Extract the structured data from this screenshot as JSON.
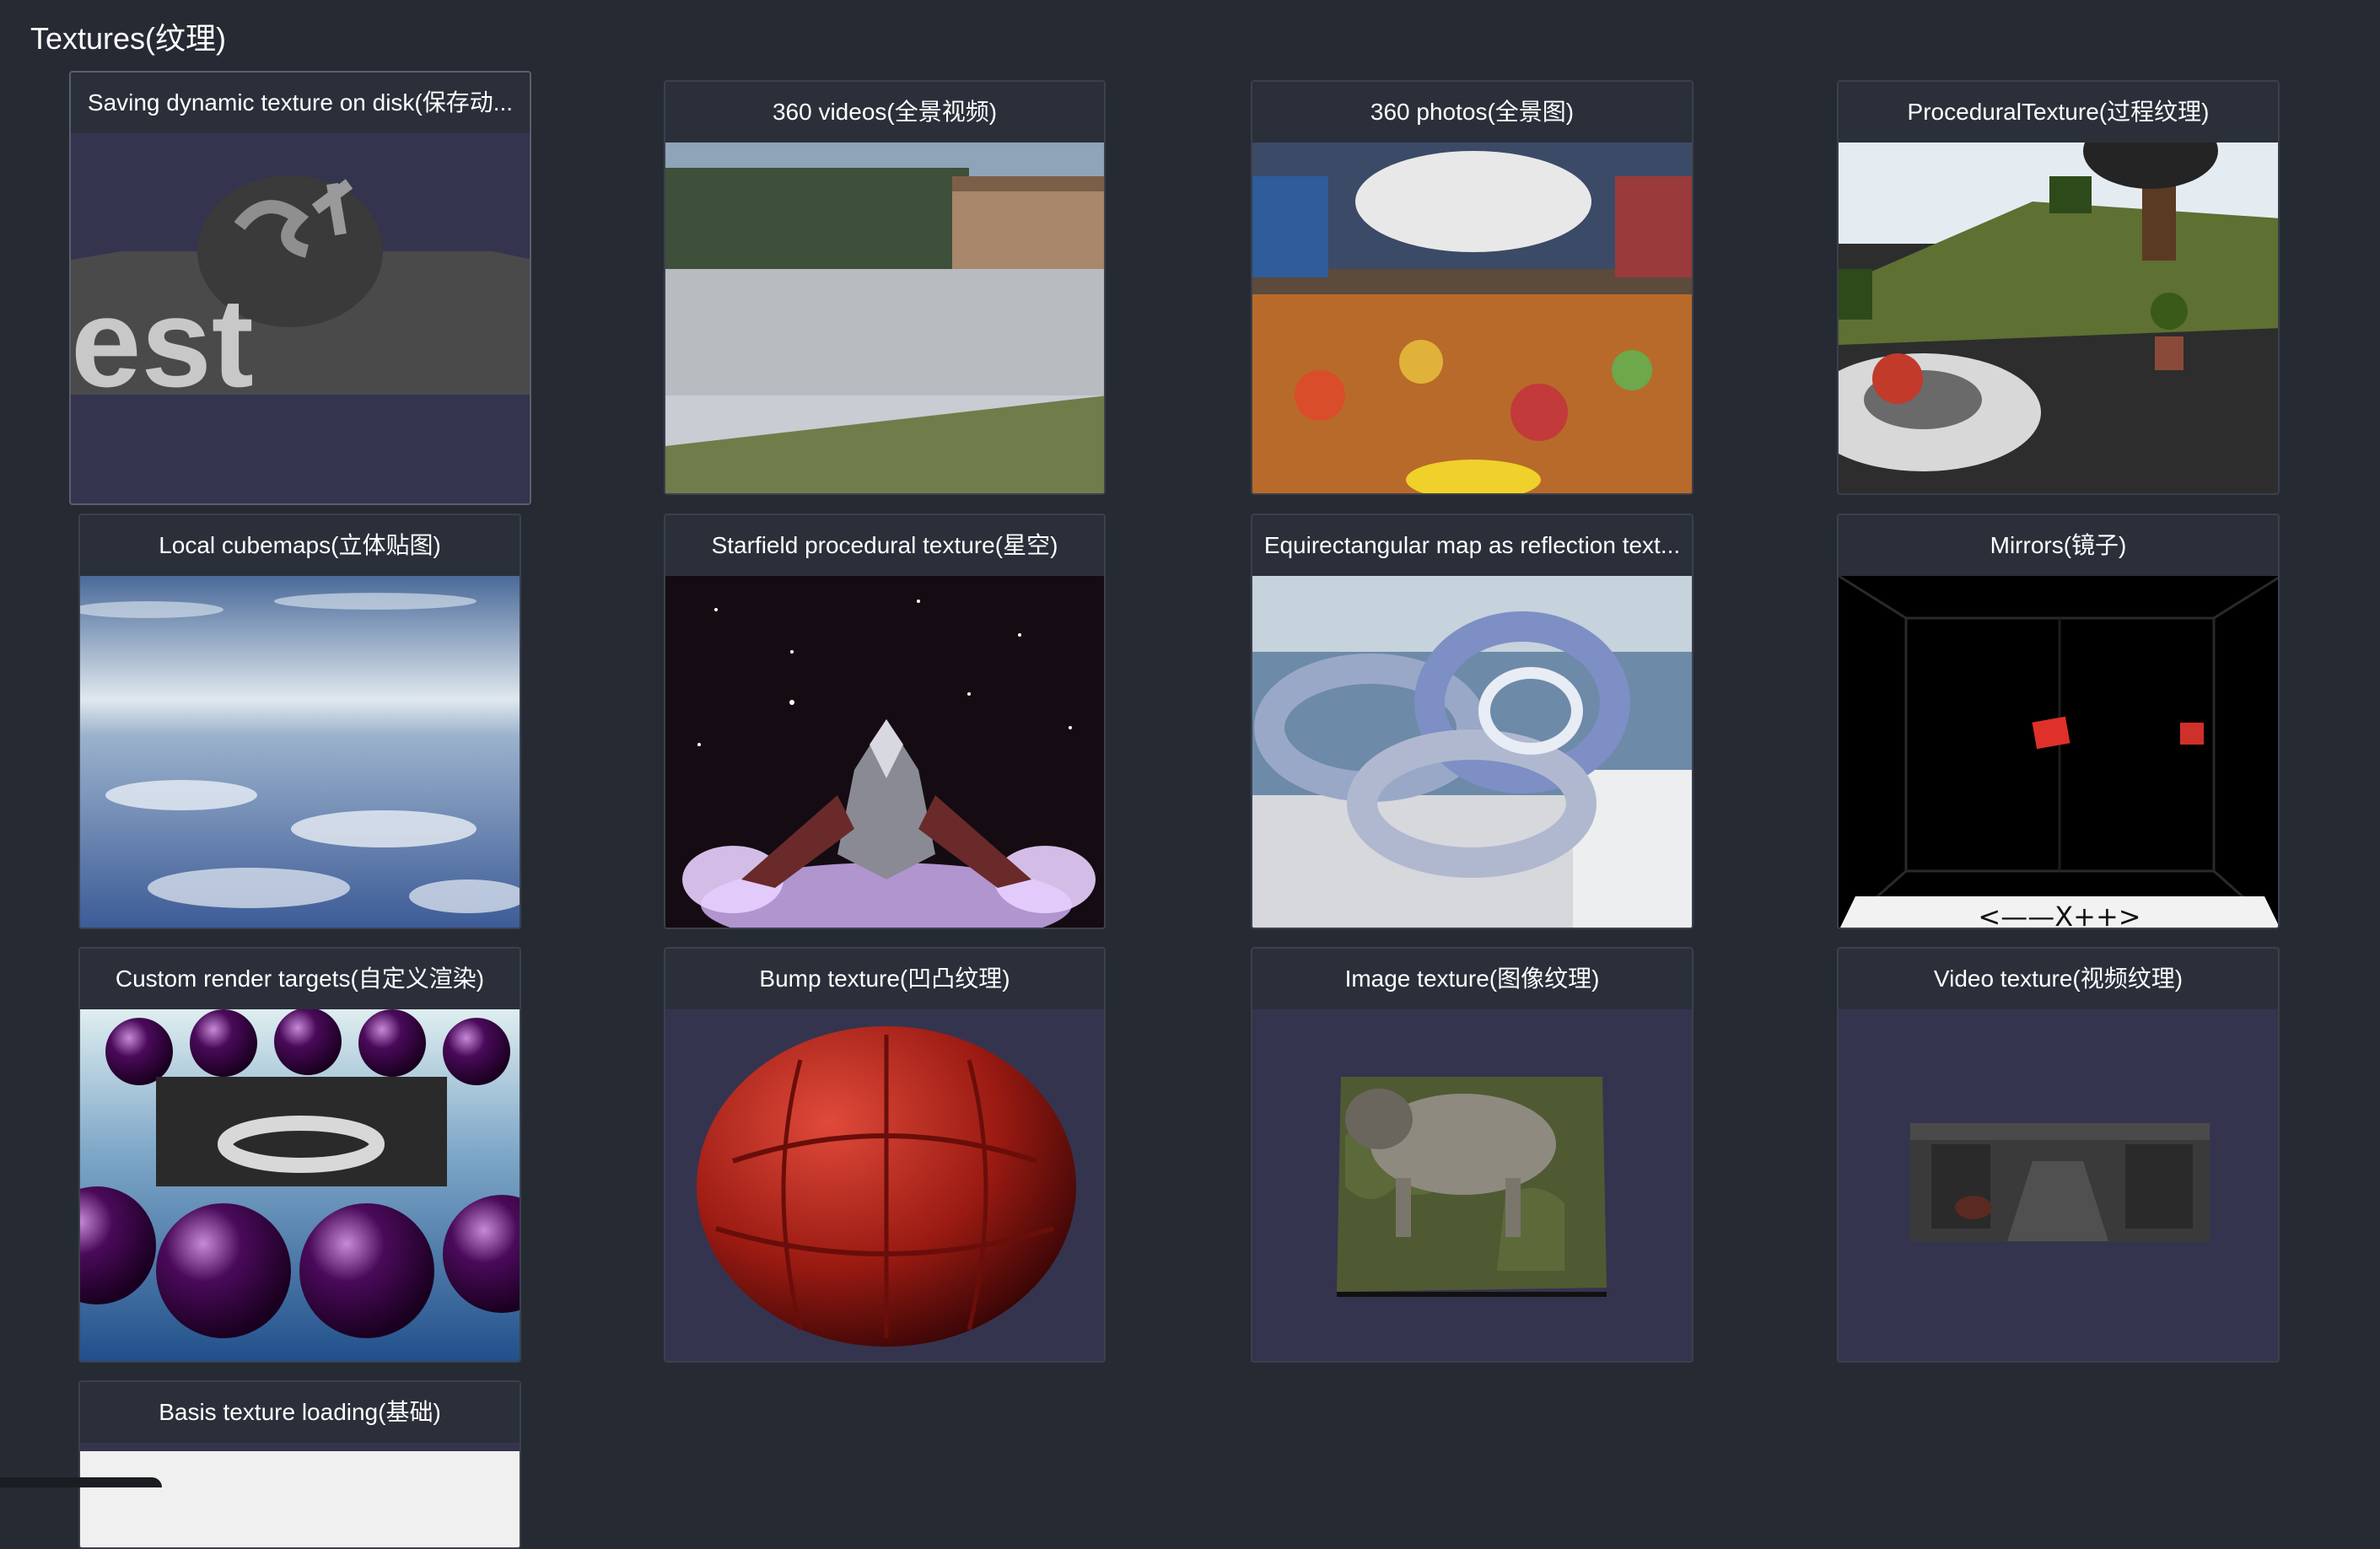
{
  "page": {
    "title": "Textures(纹理)"
  },
  "cards": [
    {
      "title": "Saving dynamic texture on disk(保存动...",
      "icon": "dynamic-texture-preview"
    },
    {
      "title": "360 videos(全景视频)",
      "icon": "panorama-video-preview"
    },
    {
      "title": "360 photos(全景图)",
      "icon": "panorama-photo-preview"
    },
    {
      "title": "ProceduralTexture(过程纹理)",
      "icon": "procedural-texture-preview"
    },
    {
      "title": "Local cubemaps(立体贴图)",
      "icon": "cubemap-sky-preview"
    },
    {
      "title": "Starfield procedural texture(星空)",
      "icon": "starfield-spaceship-preview"
    },
    {
      "title": "Equirectangular map as reflection text...",
      "icon": "reflection-torus-knot-preview"
    },
    {
      "title": "Mirrors(镜子)",
      "icon": "mirror-room-preview"
    },
    {
      "title": "Custom render targets(自定义渲染)",
      "icon": "render-target-spheres-preview"
    },
    {
      "title": "Bump texture(凹凸纹理)",
      "icon": "bump-sphere-preview"
    },
    {
      "title": "Image texture(图像纹理)",
      "icon": "image-texture-dog-preview"
    },
    {
      "title": "Video texture(视频纹理)",
      "icon": "video-texture-preview"
    },
    {
      "title": "Basis texture loading(基础)",
      "icon": "basis-texture-preview"
    }
  ]
}
